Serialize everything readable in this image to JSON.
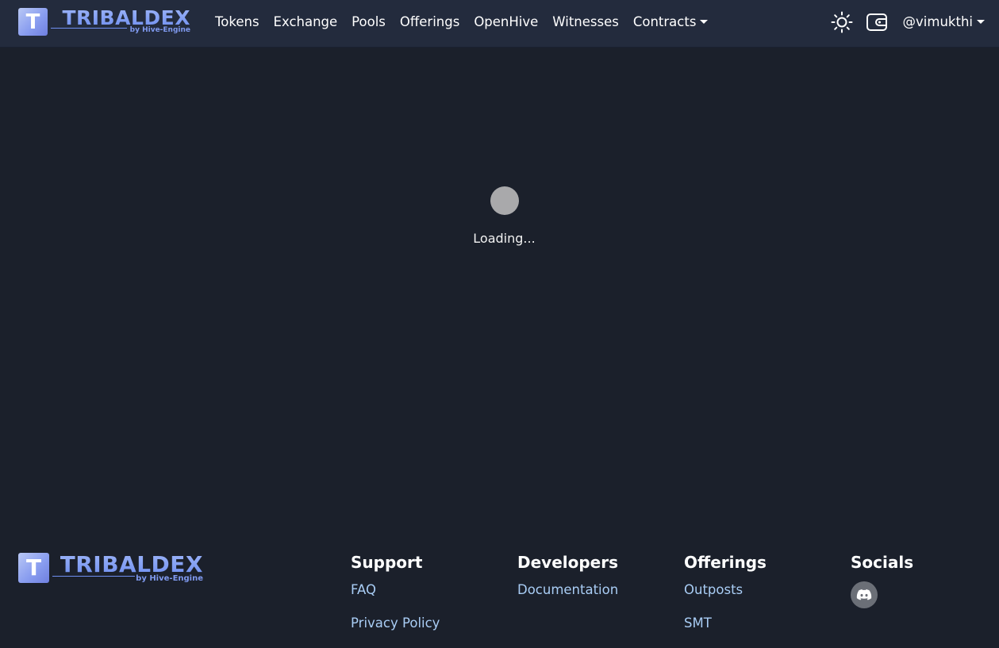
{
  "brand": {
    "logo_letter": "T",
    "title": "TRIBALDEX",
    "subtitle": "by Hive-Engine"
  },
  "nav": {
    "items": [
      {
        "label": "Tokens"
      },
      {
        "label": "Exchange"
      },
      {
        "label": "Pools"
      },
      {
        "label": "Offerings"
      },
      {
        "label": "OpenHive"
      },
      {
        "label": "Witnesses"
      },
      {
        "label": "Contracts"
      }
    ],
    "user": "@vimukthi",
    "icons": [
      "sun-icon",
      "wallet-icon"
    ]
  },
  "main": {
    "loading_text": "Loading..."
  },
  "footer": {
    "support": {
      "heading": "Support",
      "links": [
        "FAQ",
        "Privacy Policy"
      ]
    },
    "developers": {
      "heading": "Developers",
      "links": [
        "Documentation"
      ]
    },
    "offerings": {
      "heading": "Offerings",
      "links": [
        "Outposts",
        "SMT"
      ]
    },
    "socials": {
      "heading": "Socials",
      "icons": [
        "discord-icon"
      ]
    }
  },
  "colors": {
    "background": "#1b202b",
    "navbar": "#232b3d",
    "link": "#a9cdf5",
    "brand_blue": "#7f99ee",
    "loader": "#a9a9ab"
  }
}
